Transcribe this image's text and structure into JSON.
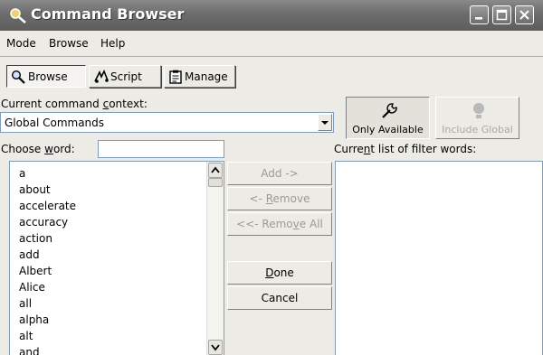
{
  "window": {
    "title": "Command Browser"
  },
  "menu": {
    "items": [
      "Mode",
      "Browse",
      "Help"
    ]
  },
  "toolbar": {
    "tabs": [
      {
        "label": "Browse",
        "icon": "magnifier-icon",
        "pressed": true
      },
      {
        "label": "Script",
        "icon": "script-icon",
        "pressed": false
      },
      {
        "label": "Manage",
        "icon": "clipboard-icon",
        "pressed": false
      }
    ]
  },
  "context": {
    "label_pre": "Current command ",
    "label_ul": "c",
    "label_post": "ontext:",
    "value": "Global Commands"
  },
  "options": {
    "only_available": "Only Available",
    "include_global": "Include Global"
  },
  "word": {
    "label_pre": "Choose ",
    "label_ul": "w",
    "label_post": "ord:",
    "value": ""
  },
  "filter": {
    "label_pre": "Curre",
    "label_ul": "n",
    "label_post": "t list of filter words:"
  },
  "words": [
    "a",
    "about",
    "accelerate",
    "accuracy",
    "action",
    "add",
    "Albert",
    "Alice",
    "all",
    "alpha",
    "alt",
    "and"
  ],
  "buttons": {
    "add": "Add ->",
    "remove_pre": "<- ",
    "remove_ul": "R",
    "remove_post": "emove",
    "remove_all_pre": "<<- Remo",
    "remove_all_ul": "v",
    "remove_all_post": "e All",
    "done_ul": "D",
    "done_post": "one",
    "cancel": "Cancel"
  }
}
